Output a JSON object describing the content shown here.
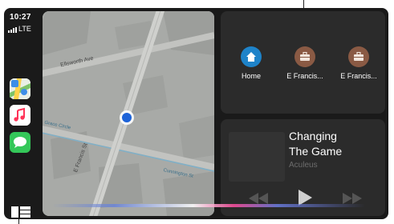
{
  "status": {
    "time": "10:27",
    "network": "LTE"
  },
  "dock": {
    "apps": [
      {
        "name": "Maps",
        "icon": "maps-icon"
      },
      {
        "name": "Music",
        "icon": "music-icon"
      },
      {
        "name": "Messages",
        "icon": "messages-icon"
      }
    ],
    "dashboard_icon": "dashboard-icon"
  },
  "map": {
    "streets": [
      "Ellsworth Ave",
      "E Francis St",
      "Cunnington St",
      "Grace Circle"
    ]
  },
  "destinations": [
    {
      "label": "Home",
      "icon": "home-icon",
      "color": "#1e83c9"
    },
    {
      "label": "E Francis...",
      "icon": "briefcase-icon",
      "color": "#8a5a44"
    },
    {
      "label": "E Francis...",
      "icon": "briefcase-icon",
      "color": "#8a5a44"
    }
  ],
  "now_playing": {
    "title_line1": "Changing",
    "title_line2": "The Game",
    "artist": "Aculeus"
  },
  "colors": {
    "location_dot": "#1d63d8",
    "accent_blue": "#1e83c9",
    "brown": "#8a5a44"
  }
}
